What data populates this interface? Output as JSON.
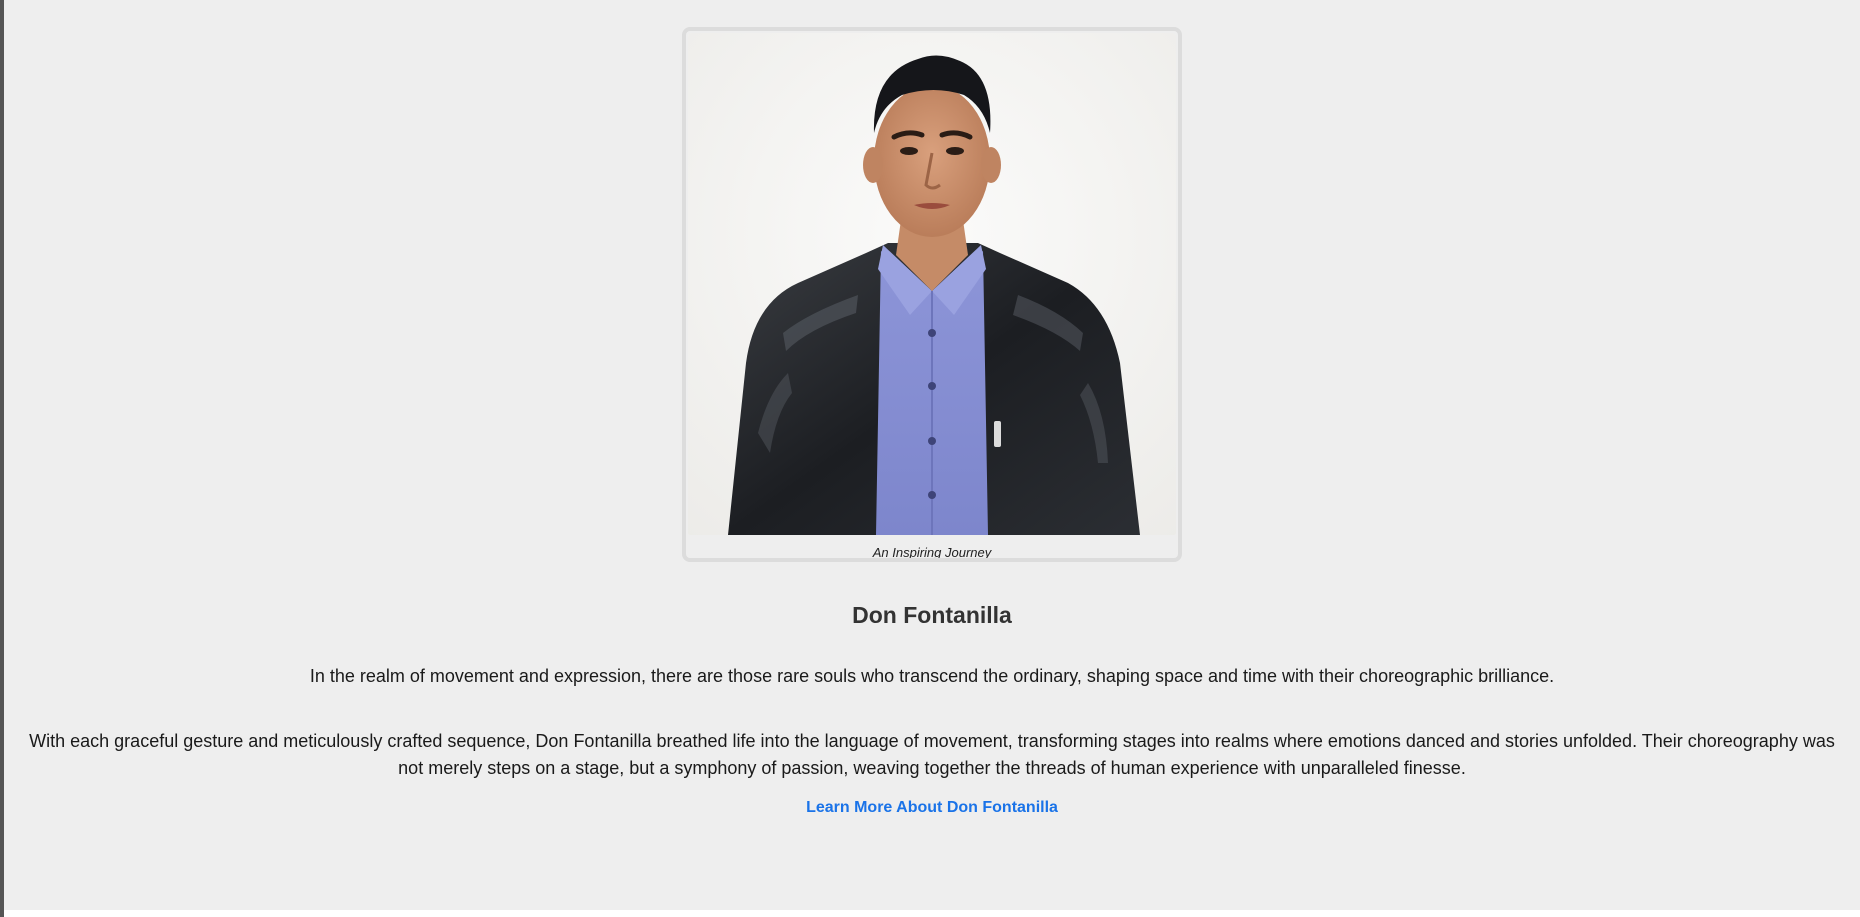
{
  "profile": {
    "photo_caption": "An Inspiring Journey",
    "name": "Don Fontanilla",
    "intro": "In the realm of movement and expression, there are those rare souls who transcend the ordinary, shaping space and time with their choreographic brilliance.",
    "description": "With each graceful gesture and meticulously crafted sequence, Don Fontanilla breathed life into the language of movement, transforming stages into realms where emotions danced and stories unfolded. Their choreography was not merely steps on a stage, but a symphony of passion, weaving together the threads of human experience with unparalleled finesse.",
    "learn_more_label": "Learn More About Don Fontanilla"
  },
  "colors": {
    "background": "#eeeeee",
    "link": "#1a73e8",
    "text": "#1a1a1a",
    "heading": "#333333"
  }
}
